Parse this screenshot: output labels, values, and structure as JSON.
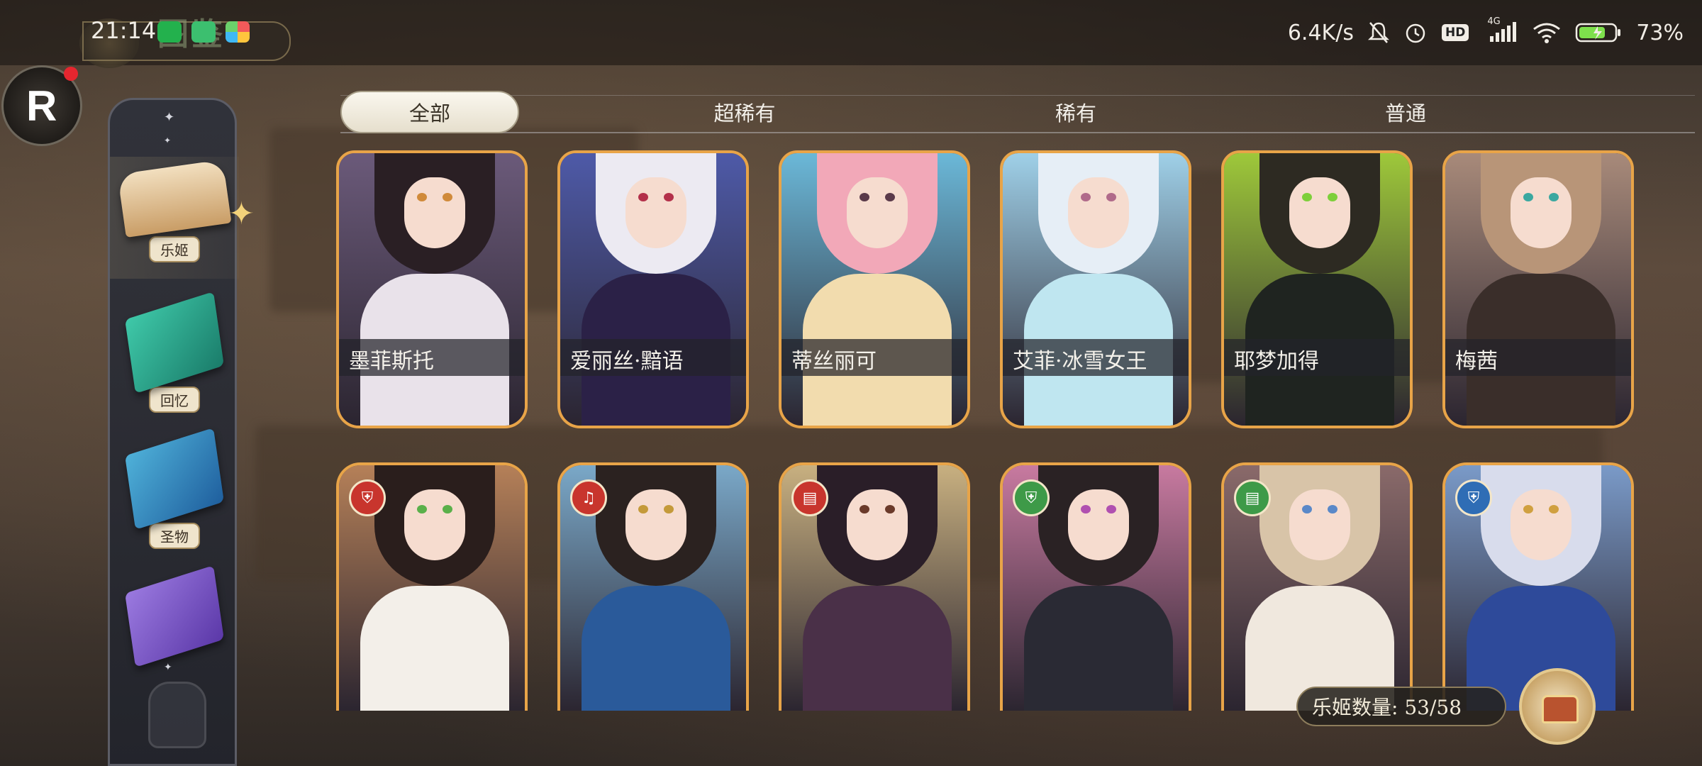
{
  "status_bar": {
    "time": "21:14",
    "network_speed": "6.4K/s",
    "hd_label": "HD",
    "signal_label": "4G",
    "battery": "73%",
    "icons": [
      "wechat-icon",
      "android-icon",
      "app-store-icon",
      "mute-bell-icon",
      "alarm-icon",
      "hd-icon",
      "signal-icon",
      "wifi-icon",
      "battery-icon"
    ]
  },
  "header": {
    "title": "图鉴"
  },
  "colors": {
    "card_border": "#e8a448",
    "active_tab_bg": "#faf7ee",
    "sidebar_bg": "#2d303a",
    "notification_dot": "#e6262f"
  },
  "logo": {
    "letter": "R"
  },
  "sidebar": {
    "items": [
      {
        "label": "乐姬",
        "icon": "open-book-icon",
        "active": true
      },
      {
        "label": "回忆",
        "icon": "green-book-icon",
        "active": false
      },
      {
        "label": "圣物",
        "icon": "blue-book-icon",
        "active": false
      },
      {
        "label": "",
        "icon": "purple-hourglass-book-icon",
        "active": false
      }
    ]
  },
  "tabs": [
    {
      "label": "全部",
      "active": true
    },
    {
      "label": "超稀有",
      "active": false
    },
    {
      "label": "稀有",
      "active": false
    },
    {
      "label": "普通",
      "active": false
    }
  ],
  "cards_row1": [
    {
      "name": "墨菲斯托",
      "hair": "#2a1f24",
      "outfit": "#e9e2ea",
      "eye": "#d08a3a",
      "bg": "#6b5a7a"
    },
    {
      "name": "爱丽丝·黯语",
      "hair": "#eceaf2",
      "outfit": "#2b2147",
      "eye": "#b3304a",
      "bg": "#4e5aa8"
    },
    {
      "name": "蒂丝丽可",
      "hair": "#f2a8b8",
      "outfit": "#f2dcae",
      "eye": "#5a3a4a",
      "bg": "#6bb8d8"
    },
    {
      "name": "艾菲·冰雪女王",
      "hair": "#e6eef6",
      "outfit": "#bfe6f0",
      "eye": "#b06a8a",
      "bg": "#9fd0e8"
    },
    {
      "name": "耶梦加得",
      "hair": "#2d2a22",
      "outfit": "#1f2420",
      "eye": "#7dcf3a",
      "bg": "#9ec83a"
    },
    {
      "name": "梅茜",
      "hair": "#b89578",
      "outfit": "#3a2e2a",
      "eye": "#3aa8a0",
      "bg": "#a88a7a"
    }
  ],
  "cards_row2": [
    {
      "badge": "shield",
      "badge_color": "red",
      "hair": "#2a1e1c",
      "outfit": "#f3efe9",
      "eye": "#5ab04a",
      "bg": "#b58058"
    },
    {
      "badge": "lyre",
      "badge_color": "red",
      "hair": "#2b2220",
      "outfit": "#2a5a9a",
      "eye": "#c49a3a",
      "bg": "#7aa8c8"
    },
    {
      "badge": "book",
      "badge_color": "red",
      "hair": "#2a1e28",
      "outfit": "#4a3048",
      "eye": "#6a3a2a",
      "bg": "#c8b080"
    },
    {
      "badge": "shield",
      "badge_color": "green",
      "hair": "#2a2224",
      "outfit": "#2a2a34",
      "eye": "#b050b0",
      "bg": "#c87aa0"
    },
    {
      "badge": "book",
      "badge_color": "green",
      "hair": "#d8c4a8",
      "outfit": "#f0e8de",
      "eye": "#5a88c8",
      "bg": "#8a6a6a"
    },
    {
      "badge": "shield",
      "badge_color": "blue",
      "hair": "#d8dcec",
      "outfit": "#2e4a9a",
      "eye": "#d0a040",
      "bg": "#7a9ac8"
    }
  ],
  "footer": {
    "count_label": "乐姬数量: 53/58"
  }
}
